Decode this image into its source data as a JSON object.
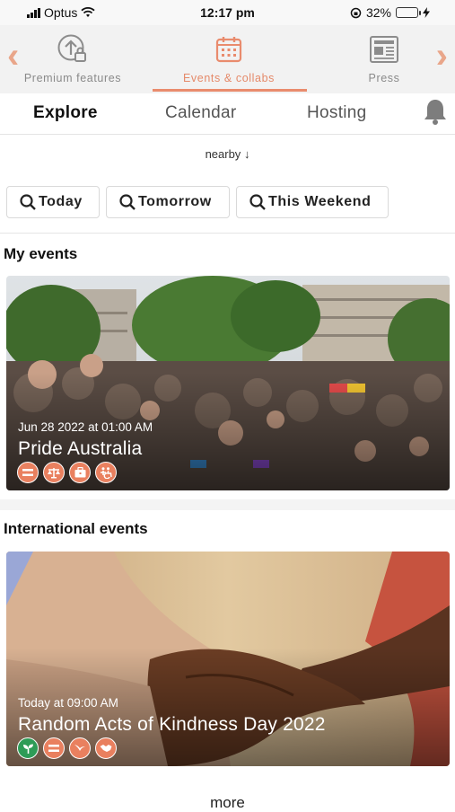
{
  "status_bar": {
    "carrier": "Optus",
    "time": "12:17 pm",
    "battery": "32%",
    "battery_level": 0.32
  },
  "features": {
    "items": [
      {
        "label": "Premium features",
        "icon": "upload-lock-icon"
      },
      {
        "label": "Events & collabs",
        "icon": "calendar-icon",
        "active": true
      },
      {
        "label": "Press",
        "icon": "newspaper-icon"
      }
    ]
  },
  "subtabs": {
    "items": [
      "Explore",
      "Calendar",
      "Hosting"
    ],
    "active": "Explore"
  },
  "nearby": "nearby",
  "filters": [
    "Today",
    "Tomorrow",
    "This Weekend"
  ],
  "my_events": {
    "heading": "My events",
    "card": {
      "date": "Jun 28 2022 at 01:00 AM",
      "title": "Pride Australia",
      "badges": [
        "equality-icon",
        "scales-icon",
        "briefcase-icon",
        "accessibility-icon"
      ]
    }
  },
  "international": {
    "heading": "International events",
    "card": {
      "date": "Today at 09:00 AM",
      "title": "Random Acts of Kindness Day 2022",
      "badges": [
        "sprout-icon",
        "equality-icon",
        "bird-icon",
        "handshake-icon"
      ]
    }
  },
  "more": "more",
  "colors": {
    "accent": "#e98b6d",
    "accent_text": "#e58a6a",
    "green_badge": "#2e9c57"
  }
}
